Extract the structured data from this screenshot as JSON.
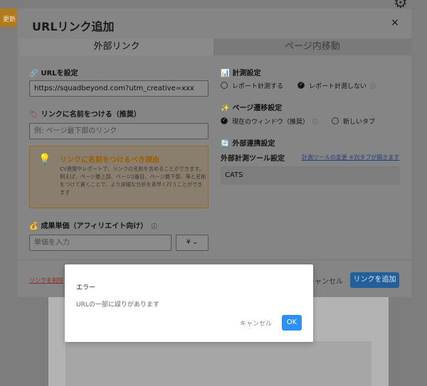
{
  "background": {
    "top_button_label": "更新",
    "gear_icon": "gear-icon"
  },
  "modal": {
    "title": "URLリンク追加",
    "close_icon": "×",
    "tabs": [
      {
        "label": "外部リンク",
        "active": true
      },
      {
        "label": "ページ内移動",
        "active": false
      }
    ],
    "url": {
      "icon": "🔗",
      "label": "URLを設定",
      "value": "https://squadbeyond.com?utm_creative=xxx"
    },
    "link_name": {
      "icon": "🏷",
      "label": "リンクに名前をつける（推奨）",
      "placeholder": "例: ページ最下部のリンク"
    },
    "reason": {
      "icon": "💡",
      "title": "リンクに名前をつけるべき理由",
      "text": "CV連報やレポートで、リンクの名前を含めることができます。例えば、ページ最上部、ページ2番目、ページ最下部、等と名前をつけて置くことで、より詳細な分析を素早く行うことができます"
    },
    "unit_price": {
      "icon": "💰",
      "label": "成果単価（アフィリエイト向け）",
      "info_icon": "ⓘ",
      "placeholder": "単価を入力",
      "currency": "¥",
      "currency_chevron": "⌄"
    },
    "measurement": {
      "icon": "📊",
      "label": "計測設定",
      "options": [
        {
          "label": "レポート計測する",
          "selected": false
        },
        {
          "label": "レポート計測しない",
          "selected": true
        }
      ]
    },
    "page_transition": {
      "icon": "✨",
      "label": "ページ遷移設定",
      "options": [
        {
          "label": "現在のウィンドウ（推奨）",
          "selected": true
        },
        {
          "label": "新しいタブ",
          "selected": false
        }
      ]
    },
    "external": {
      "icon": "🔄",
      "label": "外部連携設定",
      "tool_label": "外部計測ツール設定",
      "change_link": "計測ツールの変更 ※別タブが開きます",
      "tool_value": "CATS"
    },
    "footer": {
      "delete_link": "リンクを削除",
      "cancel": "キャンセル",
      "add": "リンクを追加"
    }
  },
  "dialog": {
    "title": "エラー",
    "message": "URLの一部に誤りがあります",
    "cancel": "キャンセル",
    "ok": "OK"
  }
}
